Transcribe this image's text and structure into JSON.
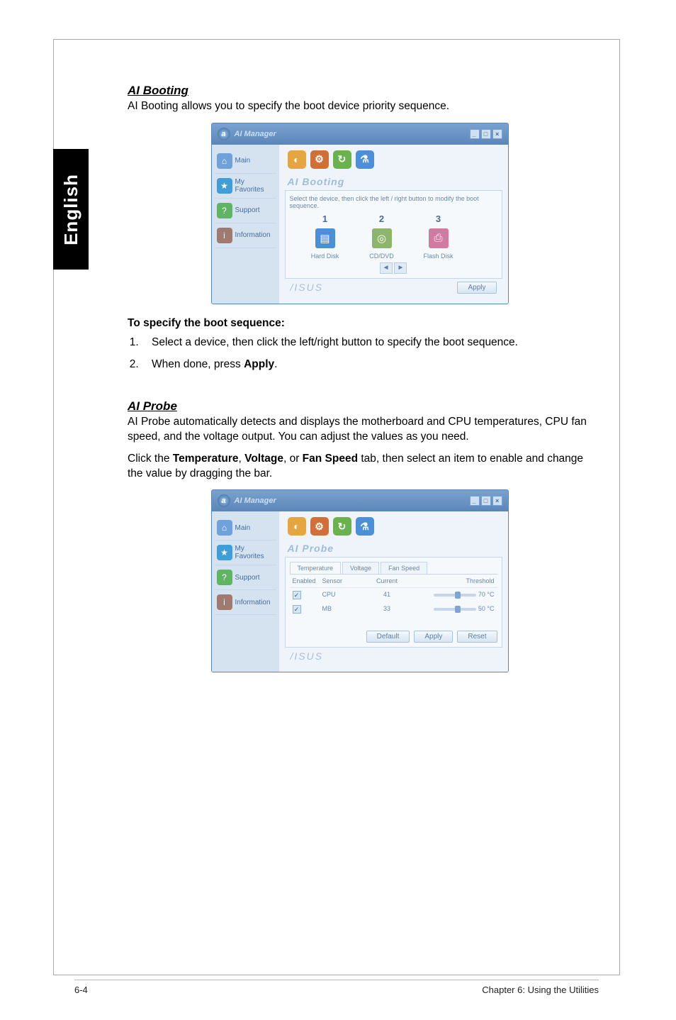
{
  "side_tab": "English",
  "section1": {
    "title": "AI Booting",
    "desc": "AI Booting allows you to specify the boot device priority sequence.",
    "sub_heading": "To specify the boot sequence:",
    "steps": [
      "Select a device, then click the left/right button to specify the boot sequence.",
      "When done, press Apply."
    ],
    "step2_prefix": "When done, press ",
    "step2_bold": "Apply",
    "step2_suffix": "."
  },
  "section2": {
    "title": "AI Probe",
    "desc": "AI Probe automatically detects and displays the motherboard and CPU temperatures, CPU fan speed, and the voltage output. You can adjust the values as you need.",
    "instr_pre": "Click the ",
    "instr_b1": "Temperature",
    "instr_mid1": ", ",
    "instr_b2": "Voltage",
    "instr_mid2": ", or ",
    "instr_b3": "Fan Speed",
    "instr_post": " tab, then select an item to enable and change the value by dragging the bar."
  },
  "window": {
    "title": "AI Manager",
    "logo_glyph": "a",
    "win_buttons": [
      "_",
      "□",
      "×"
    ],
    "sidebar": [
      {
        "label": "Main",
        "color": "#6fa2da",
        "glyph": "⌂"
      },
      {
        "label": "My Favorites",
        "color": "#3f9ed8",
        "glyph": "★"
      },
      {
        "label": "Support",
        "color": "#5fb563",
        "glyph": "?"
      },
      {
        "label": "Information",
        "color": "#a07a6f",
        "glyph": "i"
      }
    ],
    "toolbar": [
      {
        "name": "ai-disk-icon",
        "color": "#e5a642",
        "glyph": "◐"
      },
      {
        "name": "ai-gear-icon",
        "color": "#d07038",
        "glyph": "⚙"
      },
      {
        "name": "ai-booting-icon",
        "color": "#6bb24f",
        "glyph": "↻"
      },
      {
        "name": "ai-probe-icon",
        "color": "#4b8fd6",
        "glyph": "⚗"
      }
    ],
    "asus": "/ISUS"
  },
  "booting_panel": {
    "title": "AI Booting",
    "help_text": "Select the device, then click the left / right button to modify the boot sequence.",
    "columns": [
      {
        "num": "1",
        "label": "Hard Disk",
        "color": "#4b8fd6",
        "glyph": "▤"
      },
      {
        "num": "2",
        "label": "CD/DVD",
        "color": "#8db56b",
        "glyph": "◎"
      },
      {
        "num": "3",
        "label": "Flash Disk",
        "color": "#d07ba1",
        "glyph": "⎙"
      }
    ],
    "arrow_left": "◄",
    "arrow_right": "►",
    "apply": "Apply"
  },
  "probe_panel": {
    "title": "AI Probe",
    "tabs": [
      {
        "label": "Temperature",
        "active": true
      },
      {
        "label": "Voltage",
        "active": false
      },
      {
        "label": "Fan Speed",
        "active": false
      }
    ],
    "headers": {
      "enabled": "Enabled",
      "sensor": "Sensor",
      "current": "Current",
      "threshold": "Threshold"
    },
    "rows": [
      {
        "sensor": "CPU",
        "current": "41",
        "val": "70 °C"
      },
      {
        "sensor": "MB",
        "current": "33",
        "val": "50 °C"
      }
    ],
    "buttons": {
      "default": "Default",
      "apply": "Apply",
      "reset": "Reset"
    }
  },
  "footer": {
    "left": "6-4",
    "right": "Chapter 6: Using the Utilities"
  }
}
